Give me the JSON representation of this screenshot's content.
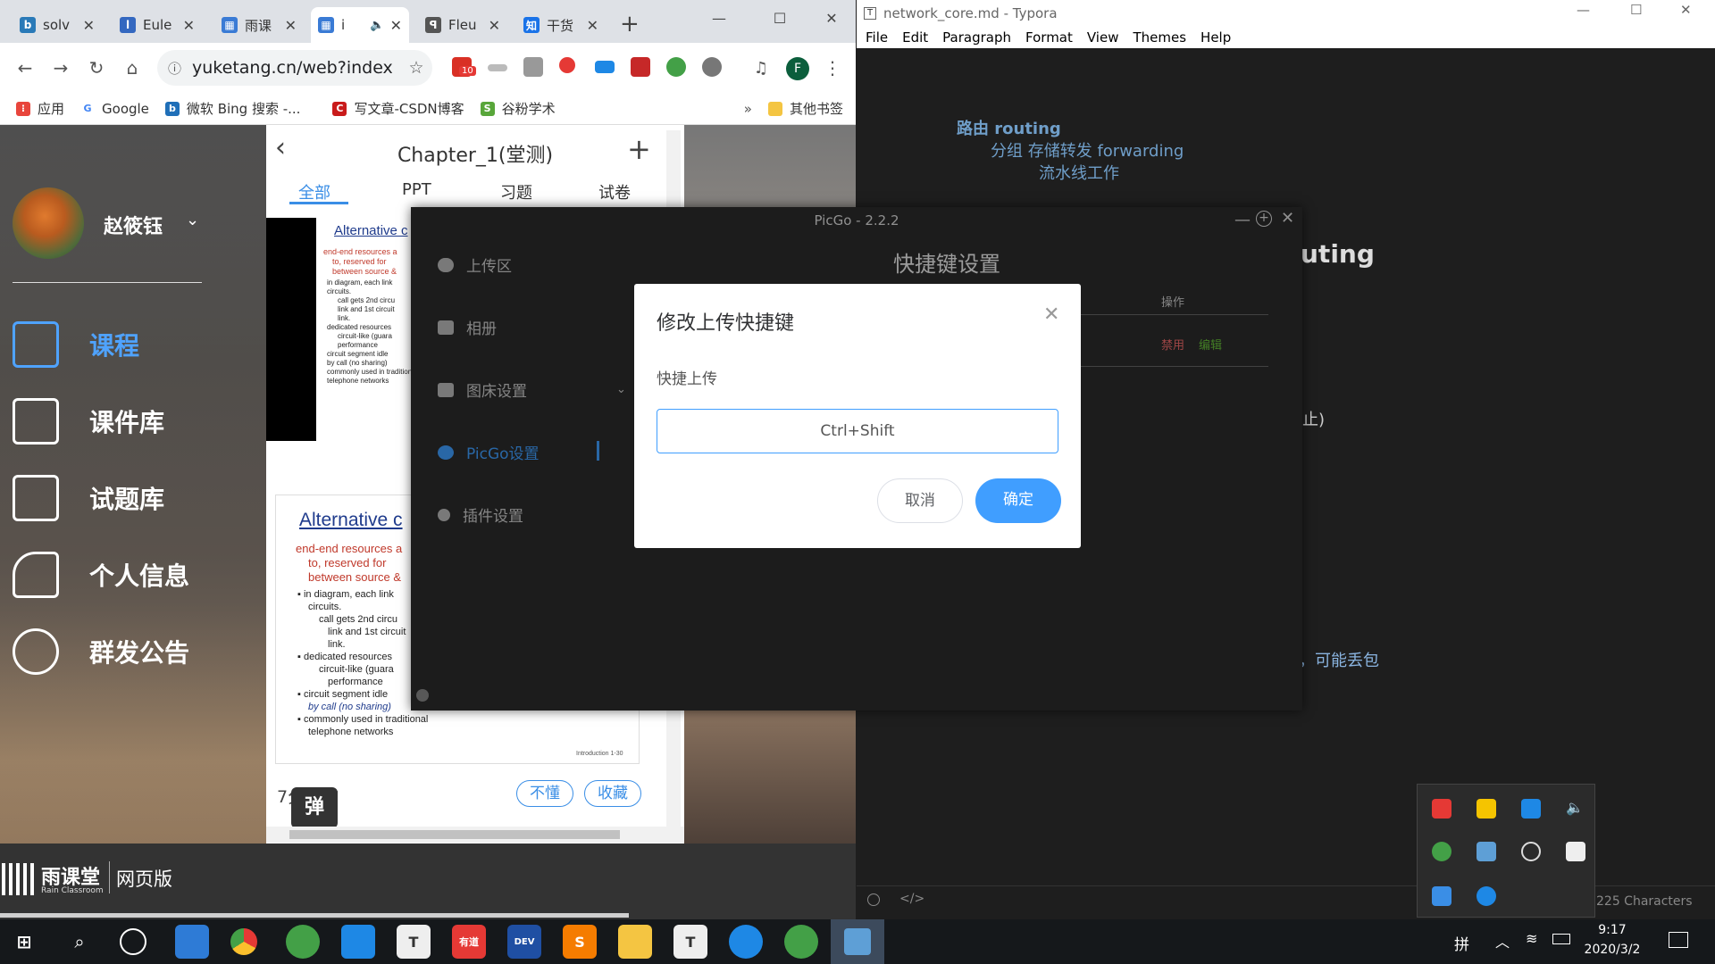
{
  "chrome": {
    "tabs": [
      {
        "title": "solv",
        "color": "#2a7ab8",
        "glyph": "b"
      },
      {
        "title": "Eule",
        "color": "#3468c0",
        "glyph": "l"
      },
      {
        "title": "雨课",
        "color": "#3a7bd5",
        "glyph": "▦"
      },
      {
        "title": "i",
        "color": "#3a7bd5",
        "glyph": "▦",
        "active": true
      },
      {
        "title": "Fleu",
        "color": "#555555",
        "glyph": "ꟼ"
      },
      {
        "title": "干货",
        "color": "#1a73e8",
        "glyph": "知"
      }
    ],
    "new_tab": "+",
    "url": "yuketang.cn/web?index",
    "bookmarks": [
      {
        "label": "应用",
        "color": "#e8453c",
        "glyph": "⁝"
      },
      {
        "label": "Google",
        "color": "#4285f4",
        "glyph": "G"
      },
      {
        "label": "微软 Bing 搜索 -...",
        "color": "#1f6fb8",
        "glyph": "b"
      },
      {
        "label": "写文章-CSDN博客",
        "color": "#c91b1b",
        "glyph": "C"
      },
      {
        "label": "谷粉学术",
        "color": "#58a63a",
        "glyph": "S"
      }
    ],
    "more_bookmarks": "»",
    "other_bookmarks": "其他书签",
    "profile_initial": "F",
    "ext_badge": "10"
  },
  "yuketang": {
    "user_name": "赵筱钰",
    "menu": [
      "课程",
      "课件库",
      "试题库",
      "个人信息",
      "群发公告"
    ],
    "chapter_title": "Chapter_1(堂测)",
    "tabs": [
      "全部",
      "PPT",
      "习题",
      "试卷"
    ],
    "slide_title": "Alternative c",
    "slide_lines_red": [
      "end-end resources a",
      "to, reserved for",
      "between source &"
    ],
    "slide_bullets": [
      "in diagram, each link",
      "circuits.",
      "call gets 2nd circu",
      "link and 1st circuit",
      "link.",
      "dedicated resources",
      "circuit-like (guara",
      "performance",
      "circuit segment idle",
      "by call (no sharing)",
      "commonly used in traditional",
      "telephone networks"
    ],
    "slide_footer": "Introduction 1-30",
    "time_ago": "7分钟前",
    "btn_dont_understand": "不懂",
    "btn_favorite": "收藏",
    "danmu_label": "弹",
    "brand": "雨课堂",
    "brand_sub": "Rain Classroom",
    "brand_version": "网页版"
  },
  "typora": {
    "window_title": "network_core.md - Typora",
    "menu": [
      "File",
      "Edit",
      "Paragraph",
      "Format",
      "View",
      "Themes",
      "Help"
    ],
    "lines": [
      "路由 routing",
      "分组  存储转发 forwarding",
      "流水线工作"
    ],
    "partial_heading": "uting",
    "partial_text_1": "止)",
    "partial_text_2": "失，可能丢包",
    "char_count": "225 Characters"
  },
  "picgo": {
    "title": "PicGo - 2.2.2",
    "page_heading": "快捷键设置",
    "sidebar": [
      "上传区",
      "相册",
      "图床设置",
      "PicGo设置",
      "插件设置"
    ],
    "table_header_action": "操作",
    "action_disable": "禁用",
    "action_edit": "编辑",
    "dialog": {
      "title": "修改上传快捷键",
      "label": "快捷上传",
      "value": "Ctrl+Shift",
      "cancel": "取消",
      "confirm": "确定"
    }
  },
  "taskbar": {
    "time": "9:17",
    "date": "2020/3/2",
    "ime": "拼"
  }
}
